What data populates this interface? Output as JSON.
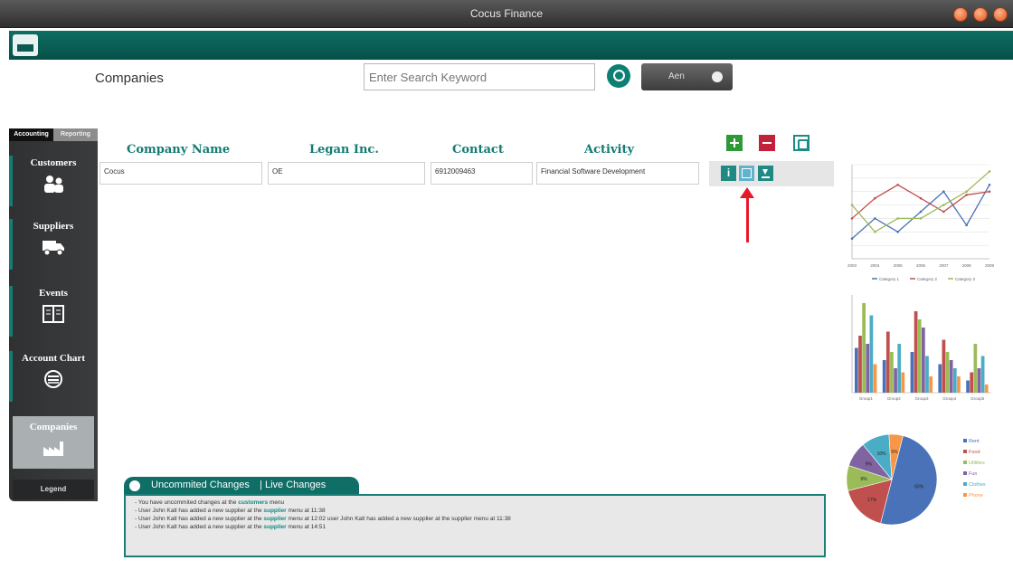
{
  "window": {
    "title": "Cocus Finance"
  },
  "header": {
    "page_title": "Companies",
    "search_placeholder": "Enter Search Keyword",
    "filter_label": "Aen"
  },
  "sidebar": {
    "tabs": [
      "Accounting",
      "Reporting"
    ],
    "items": [
      {
        "label": "Customers",
        "icon": "customers-icon"
      },
      {
        "label": "Suppliers",
        "icon": "truck-icon"
      },
      {
        "label": "Events",
        "icon": "book-icon"
      },
      {
        "label": "Account Chart",
        "icon": "chart-icon"
      },
      {
        "label": "Companies",
        "icon": "factory-icon"
      }
    ],
    "legend": "Legend"
  },
  "table": {
    "columns": [
      "Company Name",
      "Legan Inc.",
      "Contact",
      "Activity"
    ],
    "rows": [
      [
        "Cocus",
        "OE",
        "6912009463",
        "Financial Software Development"
      ]
    ]
  },
  "changes": {
    "tabs": [
      "Uncommited Changes",
      "Live Changes"
    ],
    "separator": "|",
    "log": [
      {
        "pre": "- You have uncommited changes at the ",
        "link": "customers",
        "post": " menu"
      },
      {
        "pre": "- User John Katl has added a new supplier at the ",
        "link": "supplier",
        "post": " menu at 11:38"
      },
      {
        "pre": "- User John Katl has added a new supplier at the ",
        "link": "supplier",
        "post": " menu at 12:02 user John Katl has added a new supplier at the supplier menu at 11:38"
      },
      {
        "pre": "- User John Katl has added a new supplier at the ",
        "link": "supplier",
        "post": " menu at 14:51"
      }
    ]
  },
  "chart_data": [
    {
      "type": "line",
      "x": [
        "2003",
        "2004",
        "2005",
        "2006",
        "2007",
        "2008",
        "2009"
      ],
      "series": [
        {
          "name": "Category 1",
          "values": [
            30,
            60,
            40,
            70,
            100,
            50,
            110
          ]
        },
        {
          "name": "Category 2",
          "values": [
            60,
            90,
            110,
            90,
            70,
            95,
            100
          ]
        },
        {
          "name": "Category 3",
          "values": [
            80,
            40,
            60,
            60,
            80,
            100,
            130
          ]
        }
      ],
      "ylim": [
        0,
        140
      ],
      "colors": [
        "#4a72b8",
        "#c0504d",
        "#9bbb59"
      ]
    },
    {
      "type": "bar",
      "categories": [
        "Group1",
        "Group2",
        "Group3",
        "Group4",
        "Group5"
      ],
      "series": [
        {
          "values": [
            55,
            40,
            50,
            35,
            15
          ]
        },
        {
          "values": [
            70,
            75,
            100,
            65,
            25
          ]
        },
        {
          "values": [
            110,
            50,
            90,
            50,
            60
          ]
        },
        {
          "values": [
            60,
            30,
            80,
            40,
            30
          ]
        },
        {
          "values": [
            95,
            60,
            45,
            30,
            45
          ]
        },
        {
          "values": [
            35,
            25,
            20,
            20,
            10
          ]
        }
      ],
      "ylim": [
        0,
        120
      ],
      "colors": [
        "#4a72b8",
        "#c0504d",
        "#9bbb59",
        "#8064a2",
        "#4bacc6",
        "#f79646"
      ]
    },
    {
      "type": "pie",
      "labels": [
        "Rent",
        "Food",
        "Utilities",
        "Fun",
        "Clothes",
        "Phone"
      ],
      "values": [
        50,
        17,
        9,
        9,
        10,
        5
      ],
      "slice_labels": [
        "50%",
        "17%",
        "9%",
        "9%",
        "10%",
        "5%"
      ],
      "colors": [
        "#4a72b8",
        "#c0504d",
        "#9bbb59",
        "#8064a2",
        "#4bacc6",
        "#f79646"
      ]
    }
  ]
}
